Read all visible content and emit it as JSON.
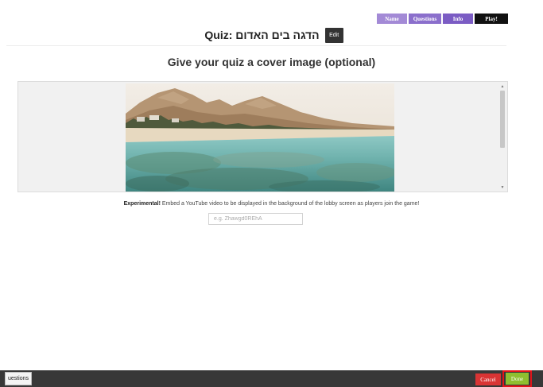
{
  "steps": {
    "name": "Name",
    "questions": "Questions",
    "info": "Info",
    "play": "Play!"
  },
  "header": {
    "title": "Quiz: הדגה בים האדום",
    "edit_label": "Edit"
  },
  "cover": {
    "heading": "Give your quiz a cover image (optional)",
    "image_subject": "beach and coral reef"
  },
  "youtube": {
    "label_strong": "Experimental!",
    "label_text": " Embed a YouTube video to be displayed in the background of the lobby screen as players join the game!",
    "placeholder": "e.g. Zhawgd0REhA"
  },
  "footer": {
    "questions_label": "uestions",
    "cancel_label": "Cancel",
    "done_label": "Done"
  },
  "colors": {
    "step_name": "#a38ad6",
    "step_questions": "#8b6fcc",
    "step_info": "#7b5cc4",
    "step_play": "#111111",
    "cancel": "#d93434",
    "done": "#8fbe30",
    "done_highlight": "#e3141a",
    "bottom_bar": "#383838"
  }
}
